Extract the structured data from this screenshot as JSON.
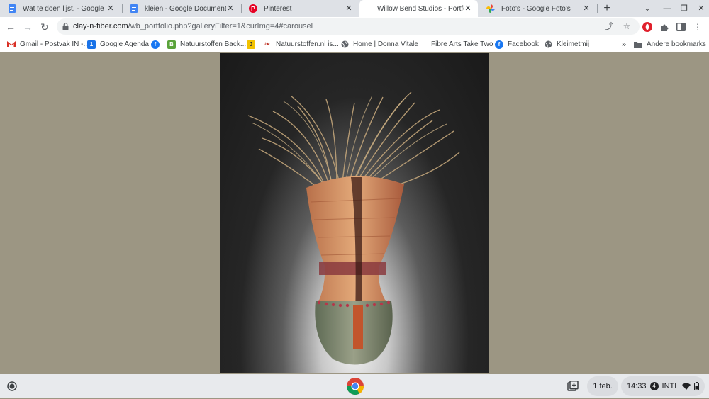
{
  "tabs": [
    {
      "title": "Wat te doen lijst. - Google Docs",
      "icon": "google-docs-icon",
      "active": false
    },
    {
      "title": "kleien - Google Documenten",
      "icon": "google-docs-icon",
      "active": false
    },
    {
      "title": "Pinterest",
      "icon": "pinterest-icon",
      "active": false
    },
    {
      "title": "Willow Bend Studios - Portfolio",
      "icon": "none",
      "active": true
    },
    {
      "title": "Foto's - Google Foto's",
      "icon": "google-photos-icon",
      "active": false
    }
  ],
  "omnibox": {
    "host": "clay-n-fiber.com",
    "path": "/wb_portfolio.php?galleryFilter=1&curImg=4#carousel"
  },
  "bookmarks": [
    {
      "label": "Gmail - Postvak IN -...",
      "icon": "gmail-icon"
    },
    {
      "label": "Google Agenda",
      "icon": "google-calendar-icon"
    },
    {
      "label": "",
      "icon": "facebook-icon"
    },
    {
      "label": "Natuurstoffen Back...",
      "icon": "b-icon"
    },
    {
      "label": "",
      "icon": "j-icon"
    },
    {
      "label": "Natuurstoffen.nl is...",
      "icon": "natuurstoffen-icon"
    },
    {
      "label": "Home | Donna Vitale",
      "icon": "globe-icon"
    },
    {
      "label": "Fibre Arts Take Two",
      "icon": "none"
    },
    {
      "label": "Facebook",
      "icon": "facebook-icon"
    },
    {
      "label": "Kleimetmij",
      "icon": "globe-icon"
    },
    {
      "label": "Andere bookmarks",
      "icon": "folder-icon"
    }
  ],
  "shelf": {
    "date": "1 feb.",
    "time": "14:33",
    "notifications": "4",
    "input_method": "INTL"
  },
  "colors": {
    "page_background": "#9c9683",
    "tabstrip": "#dee1e6",
    "shelf": "#e8eaed"
  }
}
